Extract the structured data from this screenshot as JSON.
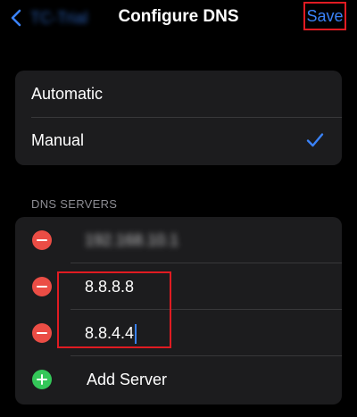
{
  "nav": {
    "back_label": "TC-Trial",
    "title": "Configure DNS",
    "save_label": "Save"
  },
  "mode": {
    "options": [
      {
        "label": "Automatic",
        "selected": false
      },
      {
        "label": "Manual",
        "selected": true
      }
    ]
  },
  "servers": {
    "header": "DNS SERVERS",
    "items": [
      {
        "value": "192.168.10.1",
        "obscured": true
      },
      {
        "value": "8.8.8.8",
        "obscured": false
      },
      {
        "value": "8.8.4.4",
        "obscured": false,
        "editing": true
      }
    ],
    "add_label": "Add Server"
  },
  "colors": {
    "background": "#000000",
    "group_background": "#1c1c1e",
    "accent": "#3a82f7",
    "remove": "#eb4d45",
    "add": "#34c759",
    "annotation": "#e01b22",
    "secondary_text": "#8d8d93"
  }
}
